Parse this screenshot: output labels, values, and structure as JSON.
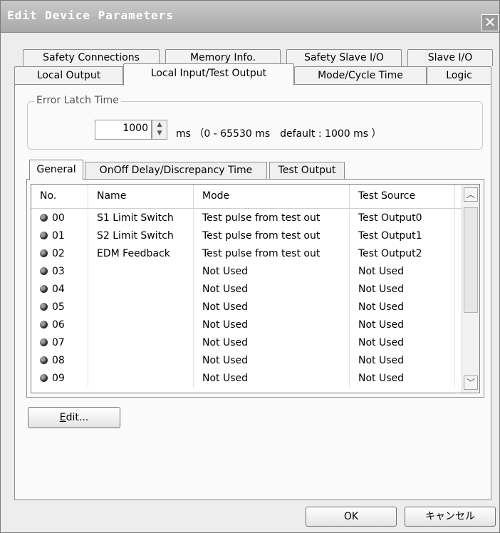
{
  "window": {
    "title": "Edit Device Parameters",
    "close_glyph": "✕"
  },
  "tabs_row1": [
    "Safety Connections",
    "Memory Info.",
    "Safety Slave I/O",
    "Slave I/O"
  ],
  "tabs_row2": [
    "Local Output",
    "Local Input/Test Output",
    "Mode/Cycle Time",
    "Logic"
  ],
  "active_tab": "Local Input/Test Output",
  "error_latch": {
    "legend": "Error Latch Time",
    "value": "1000",
    "range_text": "ms （0 - 65530 ms　default : 1000 ms ）"
  },
  "subtabs": [
    "General",
    "OnOff Delay/Discrepancy Time",
    "Test Output"
  ],
  "active_subtab": "General",
  "table": {
    "columns": [
      "No.",
      "Name",
      "Mode",
      "Test Source"
    ],
    "rows": [
      {
        "no": "00",
        "name": "S1 Limit Switch",
        "mode": "Test pulse from test out",
        "source": "Test Output0"
      },
      {
        "no": "01",
        "name": "S2 Limit Switch",
        "mode": "Test pulse from test out",
        "source": "Test Output1"
      },
      {
        "no": "02",
        "name": "EDM Feedback",
        "mode": "Test pulse from test out",
        "source": "Test Output2"
      },
      {
        "no": "03",
        "name": "",
        "mode": "Not Used",
        "source": "Not Used"
      },
      {
        "no": "04",
        "name": "",
        "mode": "Not Used",
        "source": "Not Used"
      },
      {
        "no": "05",
        "name": "",
        "mode": "Not Used",
        "source": "Not Used"
      },
      {
        "no": "06",
        "name": "",
        "mode": "Not Used",
        "source": "Not Used"
      },
      {
        "no": "07",
        "name": "",
        "mode": "Not Used",
        "source": "Not Used"
      },
      {
        "no": "08",
        "name": "",
        "mode": "Not Used",
        "source": "Not Used"
      },
      {
        "no": "09",
        "name": "",
        "mode": "Not Used",
        "source": "Not Used"
      }
    ]
  },
  "buttons": {
    "edit_mnemonic": "E",
    "edit_rest": "dit...",
    "ok": "OK",
    "cancel": "キャンセル"
  },
  "icons": {
    "row_status": "input-status-icon",
    "scroll_up": "chevron-up-icon",
    "scroll_down": "chevron-down-icon"
  }
}
